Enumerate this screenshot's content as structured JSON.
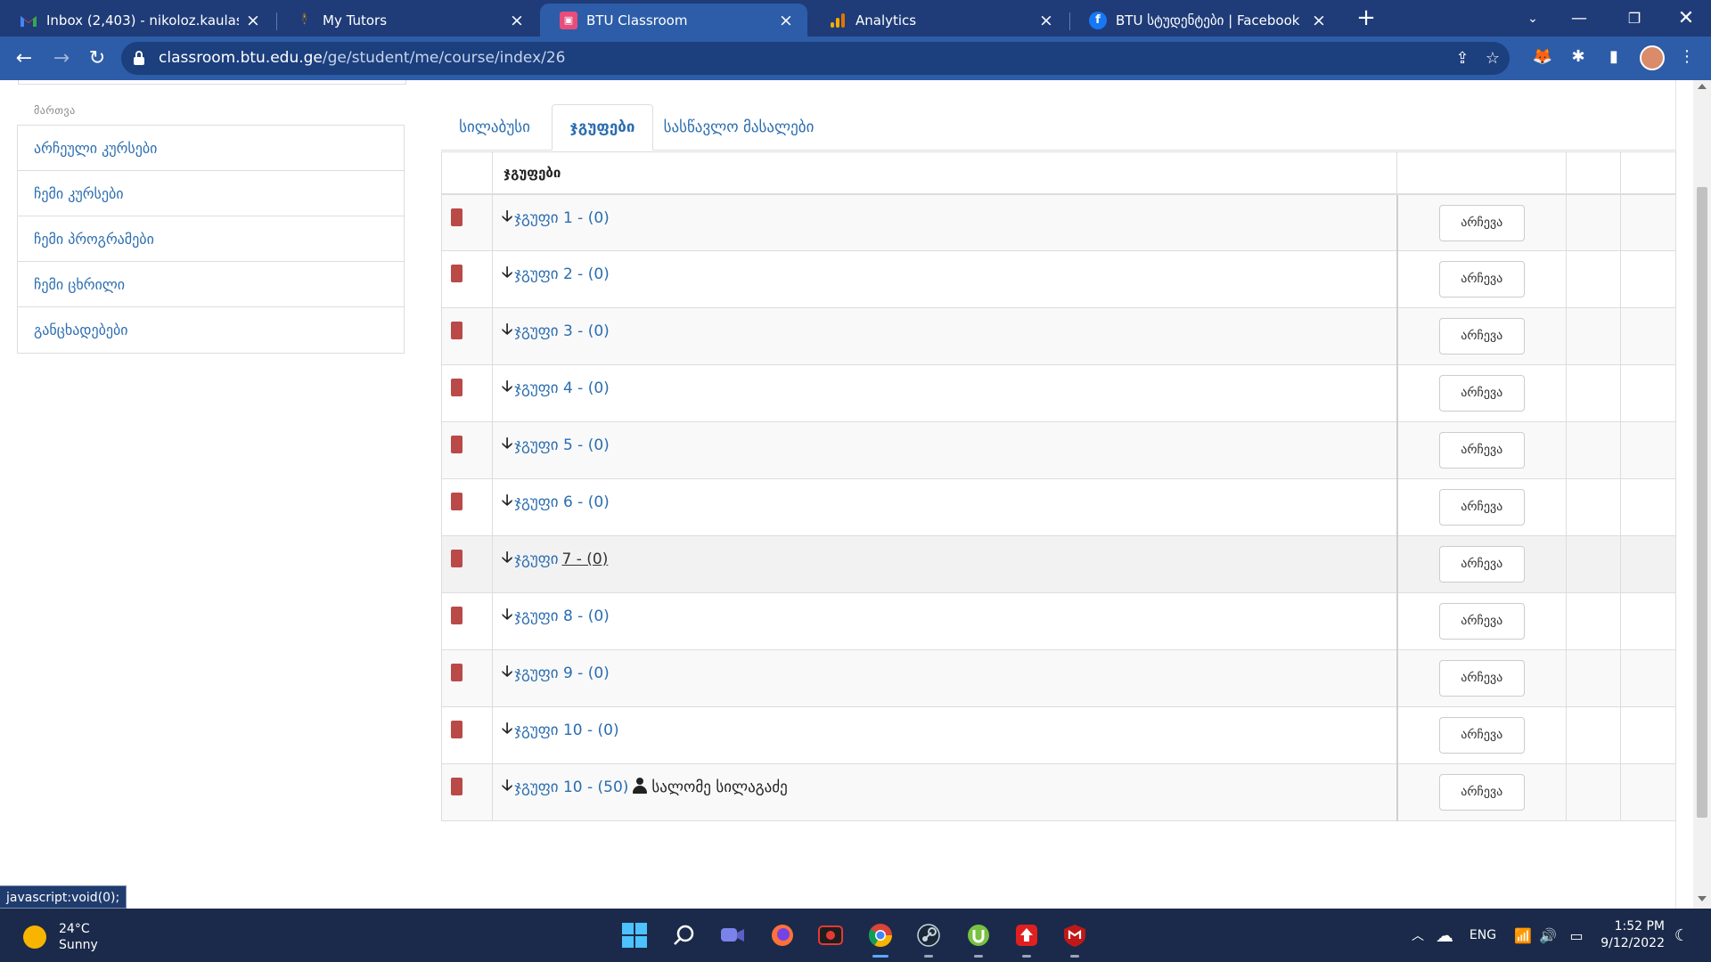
{
  "browser": {
    "tabs": [
      {
        "title": "Inbox (2,403) - nikoloz.kaulashvili",
        "icon": "gmail-icon",
        "active": false
      },
      {
        "title": "My Tutors",
        "icon": "tutor-icon",
        "active": false
      },
      {
        "title": "BTU Classroom",
        "icon": "btu-icon",
        "active": true
      },
      {
        "title": "Analytics",
        "icon": "analytics-icon",
        "active": false
      },
      {
        "title": "BTU სტუდენტები | Facebook",
        "icon": "facebook-icon",
        "active": false
      }
    ],
    "url_host": "classroom.btu.edu.ge",
    "url_path": "/ge/student/me/course/index/26"
  },
  "sidebar": {
    "heading": "მართვა",
    "items": [
      {
        "label": "არჩეული კურსები"
      },
      {
        "label": "ჩემი კურსები"
      },
      {
        "label": "ჩემი პროგრამები"
      },
      {
        "label": "ჩემი ცხრილი"
      },
      {
        "label": "განცხადებები"
      }
    ]
  },
  "content_tabs": [
    {
      "label": "სილაბუსი",
      "active": false
    },
    {
      "label": "ჯგუფები",
      "active": true
    },
    {
      "label": "სასწავლო მასალები",
      "active": false
    }
  ],
  "groups_table": {
    "header": "ჯგუფები",
    "button_label": "არჩევა",
    "rows": [
      {
        "name": "ჯგუფი",
        "link": "1 - (0)"
      },
      {
        "name": "ჯგუფი",
        "link": "2 - (0)"
      },
      {
        "name": "ჯგუფი",
        "link": "3 - (0)"
      },
      {
        "name": "ჯგუფი",
        "link": "4 - (0)"
      },
      {
        "name": "ჯგუფი",
        "link": "5 - (0)"
      },
      {
        "name": "ჯგუფი",
        "link": "6 - (0)"
      },
      {
        "name": "ჯგუფი",
        "link": "7 - (0)"
      },
      {
        "name": "ჯგუფი",
        "link": "8 - (0)"
      },
      {
        "name": "ჯგუფი",
        "link": "9 - (0)"
      },
      {
        "name": "ჯგუფი",
        "link": "10 - (0)"
      },
      {
        "name": "ჯგუფი",
        "link": "10 - (50)",
        "teacher": "სალომე სილაგაძე"
      }
    ]
  },
  "status_text": "javascript:void(0);",
  "taskbar": {
    "weather_temp": "24°C",
    "weather_desc": "Sunny",
    "language": "ENG",
    "time": "1:52 PM",
    "date": "9/12/2022"
  },
  "colors": {
    "tabstrip": "#1f3c78",
    "toolbar": "#2d5da8",
    "link": "#2a6db0",
    "marker": "#b94a48",
    "taskbar": "#1b2a4a"
  }
}
